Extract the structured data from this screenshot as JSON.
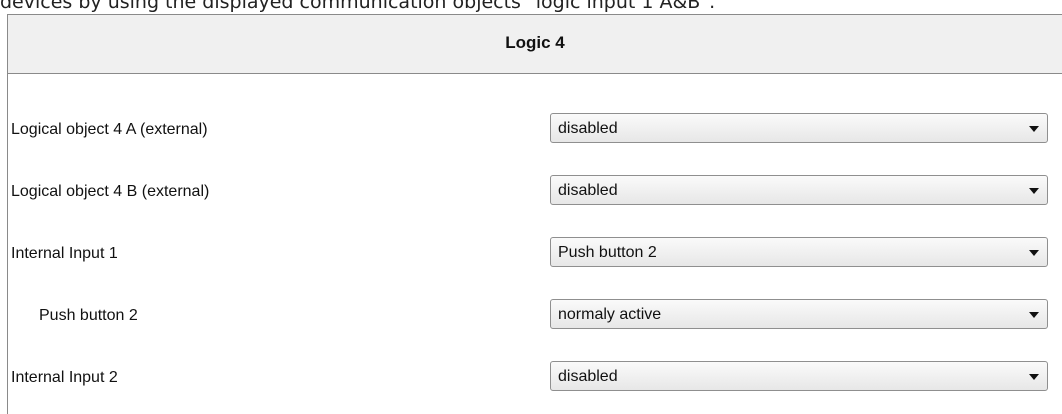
{
  "caption": "devices by using the displayed communication objects \"logic input 1 A&B\".",
  "panel": {
    "title": "Logic 4"
  },
  "rows": [
    {
      "label": "Logical object 4 A (external)",
      "value": "disabled"
    },
    {
      "label": "Logical object 4 B (external)",
      "value": "disabled"
    },
    {
      "label": "Internal Input 1",
      "value": "Push button 2"
    },
    {
      "label": "Push button 2",
      "value": "normaly active"
    },
    {
      "label": "Internal Input 2",
      "value": "disabled"
    }
  ],
  "icons": {
    "dropdown": "chevron-down-icon"
  }
}
